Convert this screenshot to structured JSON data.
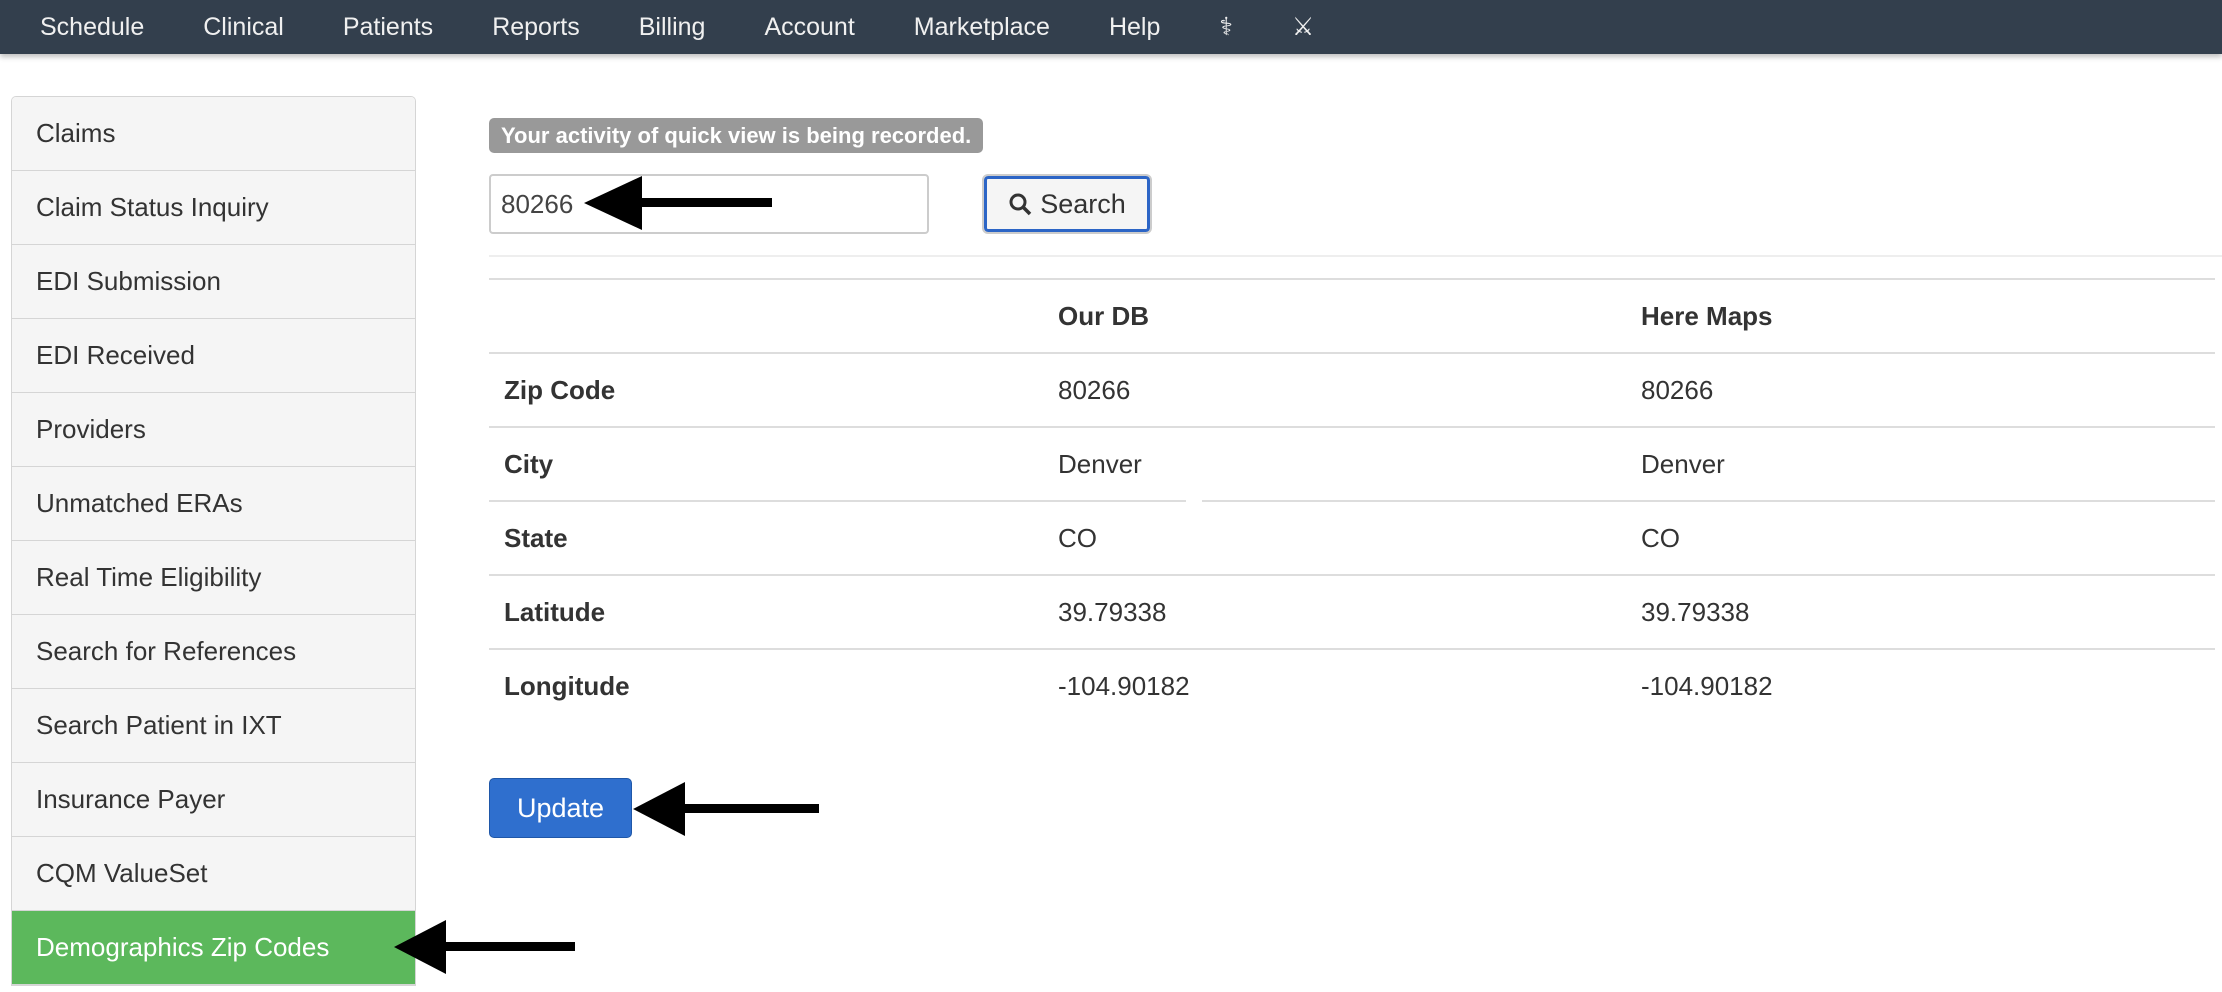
{
  "nav": {
    "items": [
      "Schedule",
      "Clinical",
      "Patients",
      "Reports",
      "Billing",
      "Account",
      "Marketplace",
      "Help"
    ],
    "icons": [
      "caduceus-icon",
      "crossed-swords-icon"
    ]
  },
  "sidebar": {
    "items": [
      "Claims",
      "Claim Status Inquiry",
      "EDI Submission",
      "EDI Received",
      "Providers",
      "Unmatched ERAs",
      "Real Time Eligibility",
      "Search for References",
      "Search Patient in IXT",
      "Insurance Payer",
      "CQM ValueSet",
      "Demographics Zip Codes"
    ],
    "active": "Demographics Zip Codes",
    "active_color": "#5cb85c"
  },
  "notice": "Your activity of quick view is being recorded.",
  "search": {
    "value": "80266",
    "button": "Search"
  },
  "table": {
    "headers": [
      "",
      "Our DB",
      "Here Maps"
    ],
    "rows": [
      [
        "Zip Code",
        "80266",
        "80266"
      ],
      [
        "City",
        "Denver",
        "Denver"
      ],
      [
        "State",
        "CO",
        "CO"
      ],
      [
        "Latitude",
        "39.79338",
        "39.79338"
      ],
      [
        "Longitude",
        "-104.90182",
        "-104.90182"
      ]
    ]
  },
  "update_button": "Update"
}
